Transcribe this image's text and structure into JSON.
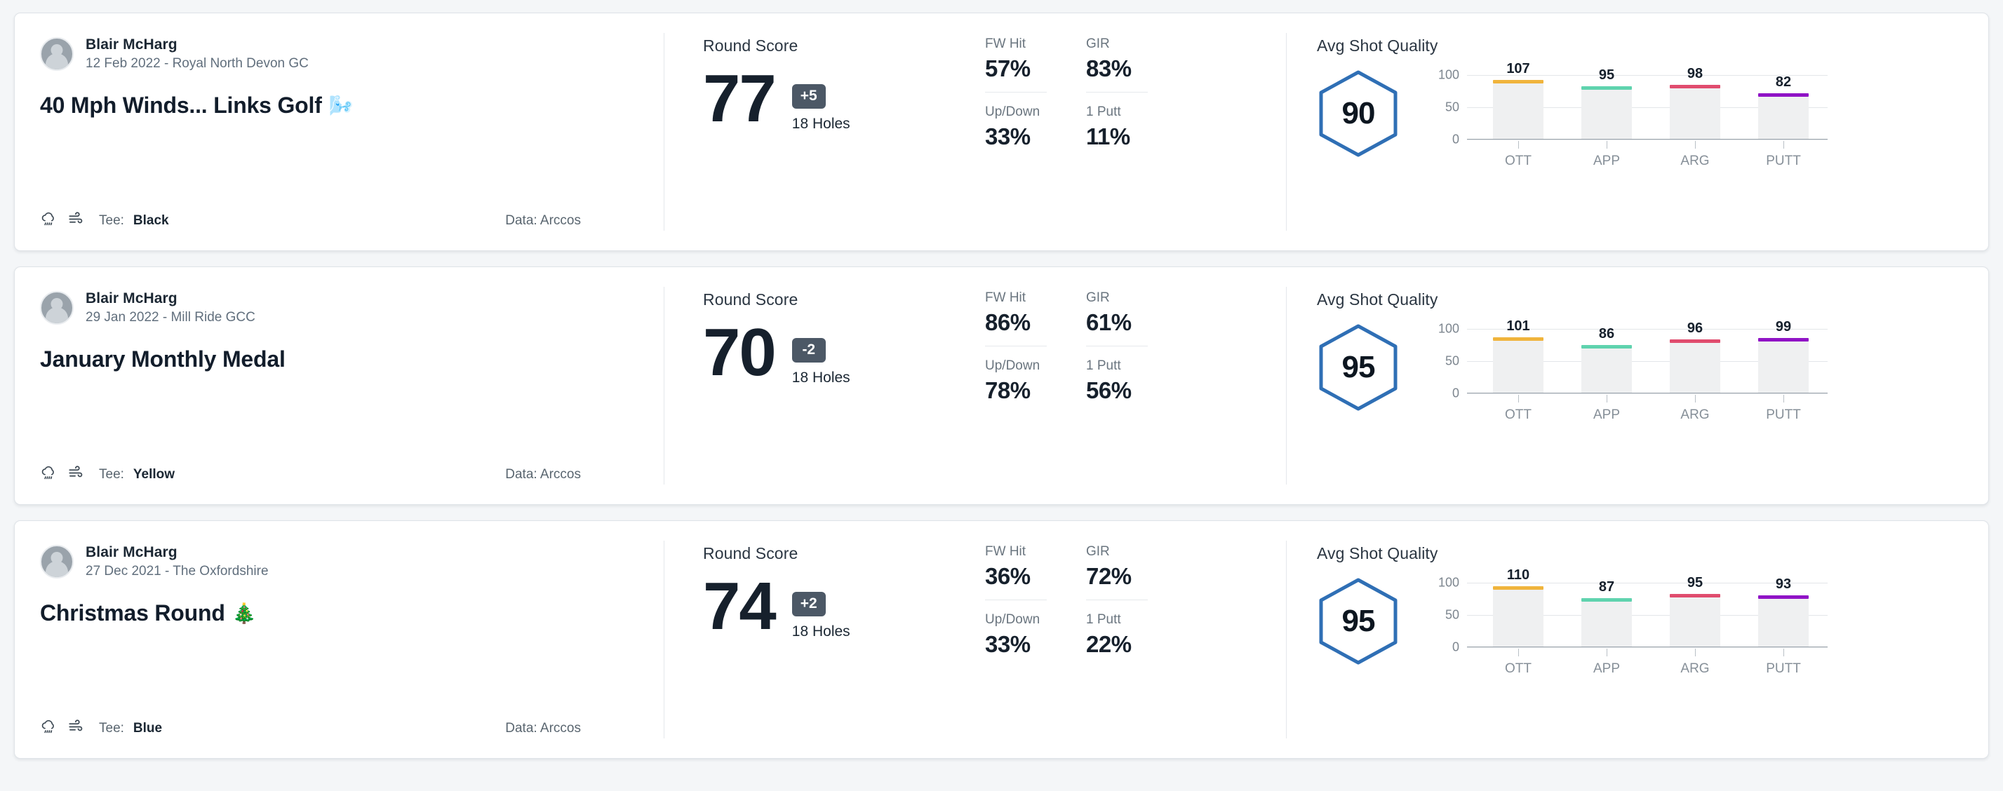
{
  "labels": {
    "round_score": "Round Score",
    "avg_shot_quality": "Avg Shot Quality",
    "holes": "18 Holes",
    "tee_prefix": "Tee:",
    "data_prefix": "Data:",
    "stat_fw": "FW Hit",
    "stat_gir": "GIR",
    "stat_updown": "Up/Down",
    "stat_1putt": "1 Putt",
    "y_100": "100",
    "y_50": "50",
    "y_0": "0"
  },
  "icons": {
    "avatar": "person-avatar-icon",
    "weather": "rain-cloud-icon",
    "wind": "wind-icon"
  },
  "colors": {
    "hexagon_stroke": "#2f6fb5",
    "badge_bg": "#4c5866",
    "bar_track": "#eff0f1",
    "ott": "#f0b43c",
    "app": "#5fd3ae",
    "arg": "#e04c6e",
    "putt": "#9013c6",
    "card_bg": "#ffffff",
    "page_bg": "#f4f6f8"
  },
  "rounds": [
    {
      "player": "Blair McHarg",
      "meta": "12 Feb 2022 - Royal North Devon GC",
      "title": "40 Mph Winds... Links Golf",
      "title_emoji": "🌬️",
      "tee": "Black",
      "data_source": "Arccos",
      "score": "77",
      "to_par": "+5",
      "holes": "18 Holes",
      "stats": {
        "fw_hit": "57%",
        "gir": "83%",
        "up_down": "33%",
        "one_putt": "11%"
      },
      "shot_quality": "90",
      "chart_data": {
        "type": "bar",
        "title": "Avg Shot Quality",
        "categories": [
          "OTT",
          "APP",
          "ARG",
          "PUTT"
        ],
        "values": [
          107,
          95,
          98,
          82
        ],
        "colors": [
          "#f0b43c",
          "#5fd3ae",
          "#e04c6e",
          "#9013c6"
        ],
        "yticks": [
          0,
          50,
          100
        ],
        "ylim": [
          0,
          125
        ],
        "xlabel": "",
        "ylabel": "",
        "grid": true,
        "legend": "none"
      }
    },
    {
      "player": "Blair McHarg",
      "meta": "29 Jan 2022 - Mill Ride GCC",
      "title": "January Monthly Medal",
      "title_emoji": "",
      "tee": "Yellow",
      "data_source": "Arccos",
      "score": "70",
      "to_par": "-2",
      "holes": "18 Holes",
      "stats": {
        "fw_hit": "86%",
        "gir": "61%",
        "up_down": "78%",
        "one_putt": "56%"
      },
      "shot_quality": "95",
      "chart_data": {
        "type": "bar",
        "title": "Avg Shot Quality",
        "categories": [
          "OTT",
          "APP",
          "ARG",
          "PUTT"
        ],
        "values": [
          101,
          86,
          96,
          99
        ],
        "colors": [
          "#f0b43c",
          "#5fd3ae",
          "#e04c6e",
          "#9013c6"
        ],
        "yticks": [
          0,
          50,
          100
        ],
        "ylim": [
          0,
          125
        ],
        "xlabel": "",
        "ylabel": "",
        "grid": true,
        "legend": "none"
      }
    },
    {
      "player": "Blair McHarg",
      "meta": "27 Dec 2021 - The Oxfordshire",
      "title": "Christmas Round",
      "title_emoji": "🎄",
      "tee": "Blue",
      "data_source": "Arccos",
      "score": "74",
      "to_par": "+2",
      "holes": "18 Holes",
      "stats": {
        "fw_hit": "36%",
        "gir": "72%",
        "up_down": "33%",
        "one_putt": "22%"
      },
      "shot_quality": "95",
      "chart_data": {
        "type": "bar",
        "title": "Avg Shot Quality",
        "categories": [
          "OTT",
          "APP",
          "ARG",
          "PUTT"
        ],
        "values": [
          110,
          87,
          95,
          93
        ],
        "colors": [
          "#f0b43c",
          "#5fd3ae",
          "#e04c6e",
          "#9013c6"
        ],
        "yticks": [
          0,
          50,
          100
        ],
        "ylim": [
          0,
          125
        ],
        "xlabel": "",
        "ylabel": "",
        "grid": true,
        "legend": "none"
      }
    }
  ]
}
